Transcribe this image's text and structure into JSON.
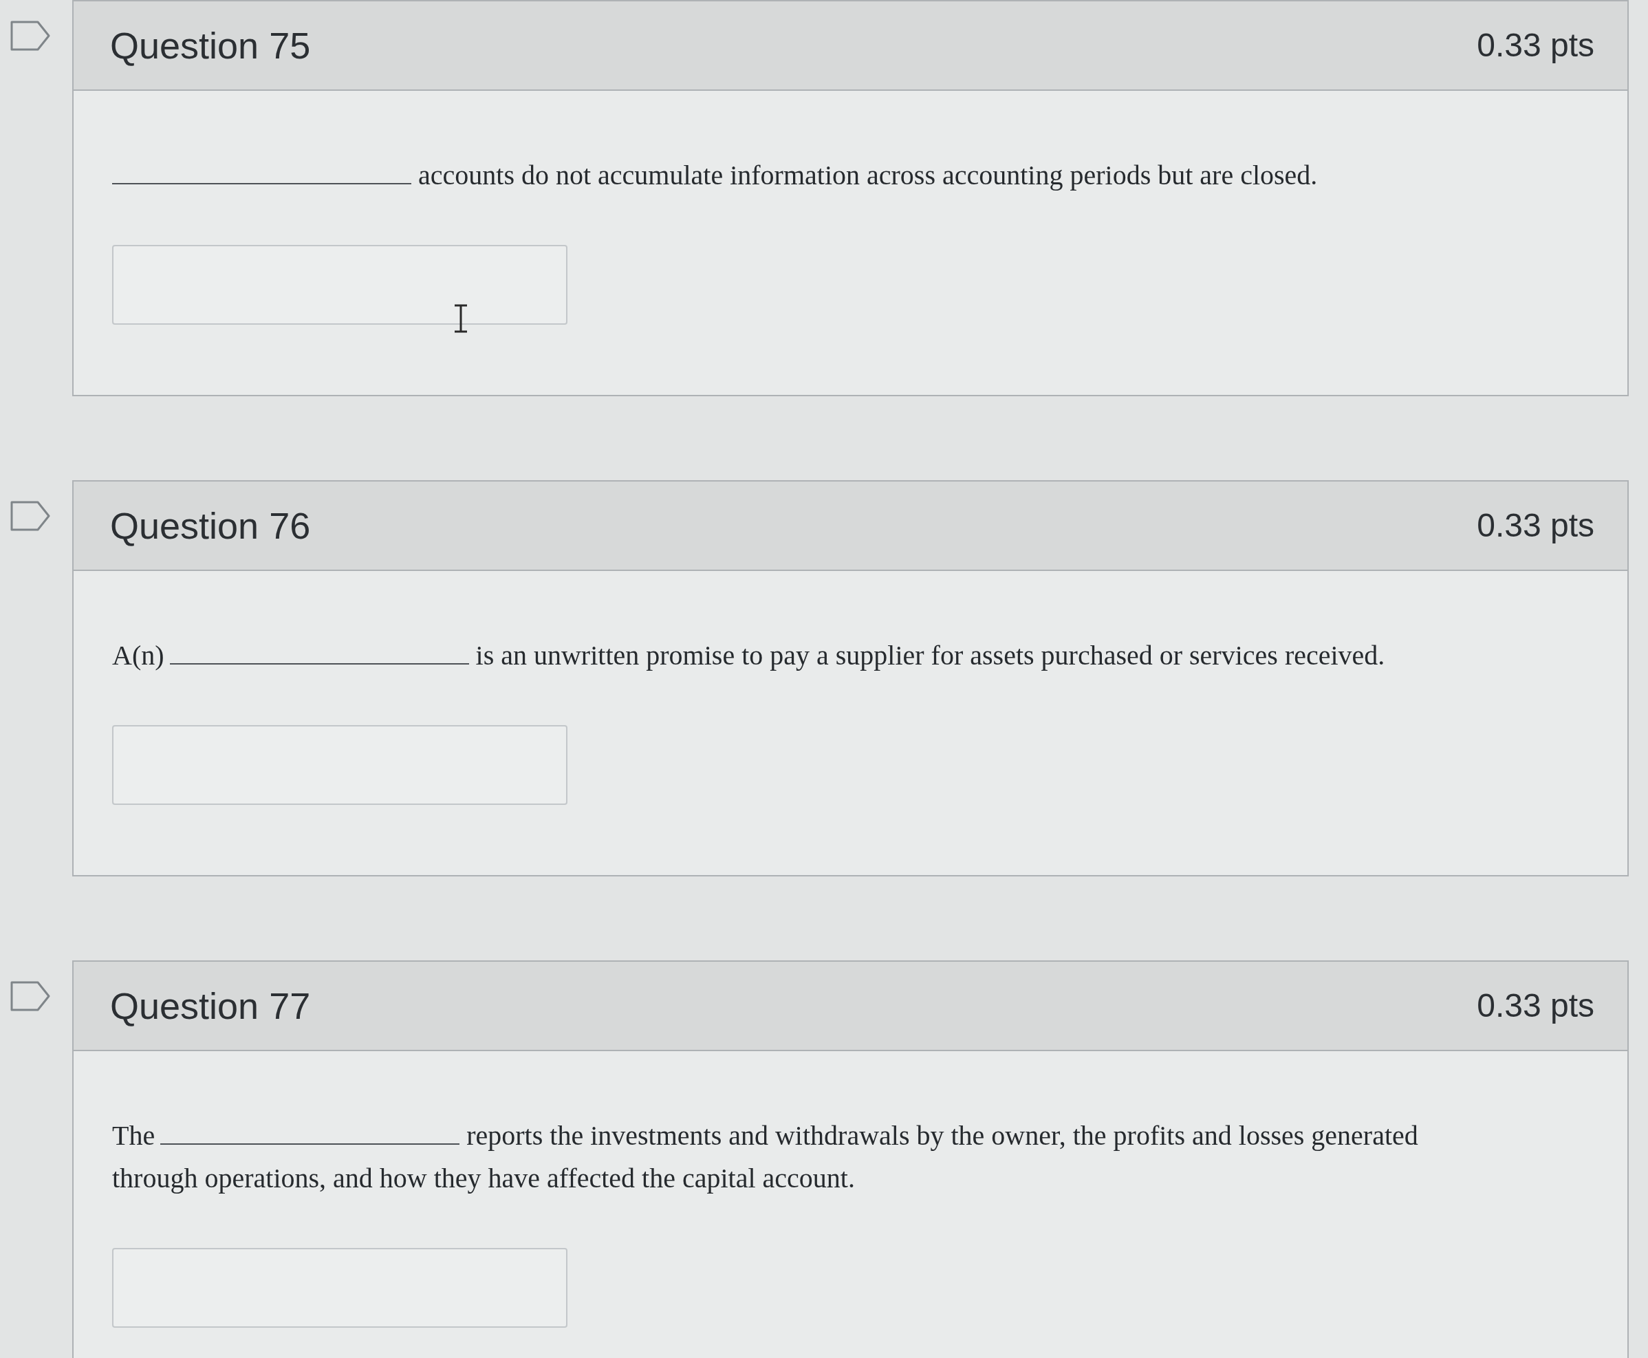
{
  "questions": [
    {
      "title": "Question 75",
      "points": "0.33 pts",
      "prompt": {
        "after": "accounts do not accumulate information across accounting periods but are closed."
      },
      "text_cursor_shown": true
    },
    {
      "title": "Question 76",
      "points": "0.33 pts",
      "prompt": {
        "before": "A(n)",
        "after": "is an unwritten promise to pay a supplier for assets purchased or services received."
      },
      "text_cursor_shown": false
    },
    {
      "title": "Question 77",
      "points": "0.33 pts",
      "prompt": {
        "before": "The",
        "after": "reports the investments and withdrawals by the owner, the profits and losses generated",
        "continuation": "through operations, and how they have affected the capital account."
      },
      "text_cursor_shown": false
    }
  ]
}
